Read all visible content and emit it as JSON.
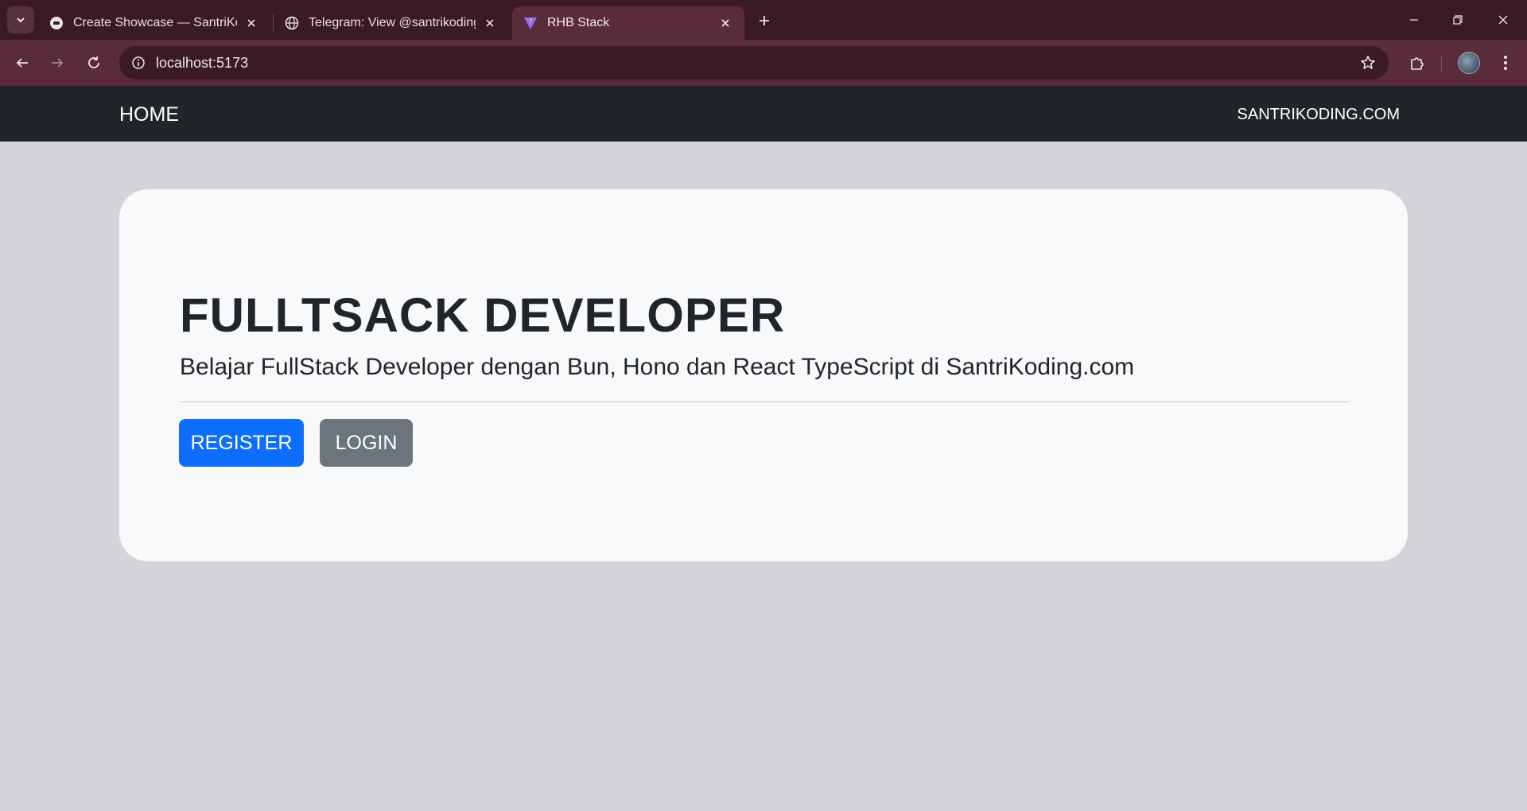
{
  "browser": {
    "tabs": [
      {
        "title": "Create Showcase — SantriKodir",
        "favicon": "santrikoding-icon"
      },
      {
        "title": "Telegram: View @santrikoding",
        "favicon": "globe-icon"
      },
      {
        "title": "RHB Stack",
        "favicon": "vite-icon",
        "active": true
      }
    ],
    "url": "localhost:5173"
  },
  "navbar": {
    "brand": "HOME",
    "link": "SANTRIKODING.COM"
  },
  "hero": {
    "title": "FULLTSACK DEVELOPER",
    "subtitle": "Belajar FullStack Developer dengan Bun, Hono dan React TypeScript di SantriKoding.com",
    "register_label": "REGISTER",
    "login_label": "LOGIN"
  },
  "colors": {
    "chrome_dark": "#3a1a25",
    "chrome_toolbar": "#5a2c3b",
    "navbar_bg": "#212529",
    "page_bg": "#d5d3d7",
    "card_bg": "#f8f9fa",
    "primary": "#0d6efd",
    "secondary": "#6c757d"
  }
}
